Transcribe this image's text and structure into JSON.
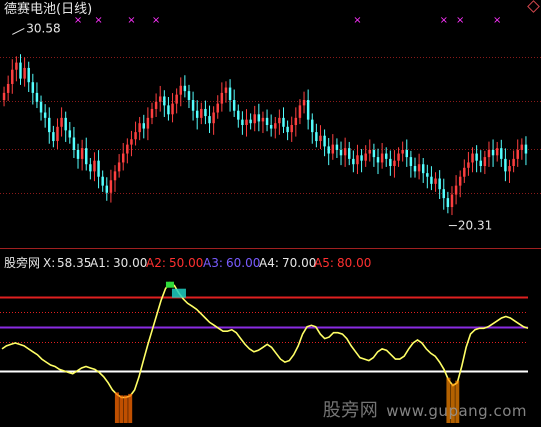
{
  "header": {
    "stock_title": "德赛电池(日线)",
    "indicator_name": "股旁网",
    "params": [
      {
        "label": "X:",
        "value": "58.35",
        "color": "#e6e6e6"
      },
      {
        "label": "A1:",
        "value": "30.00",
        "color": "#e6e6e6"
      },
      {
        "label": "A2:",
        "value": "50.00",
        "color": "#ff3030"
      },
      {
        "label": "A3:",
        "value": "60.00",
        "color": "#7a5cff"
      },
      {
        "label": "A4:",
        "value": "70.00",
        "color": "#e6e6e6"
      },
      {
        "label": "A5:",
        "value": "80.00",
        "color": "#ff3030"
      }
    ]
  },
  "watermark": {
    "text": "股旁网",
    "url": "www.gupang.com"
  },
  "colors": {
    "up": "#ff4040",
    "down": "#54ffff",
    "line": "#ffff66",
    "level_red": "#e02020",
    "level_purple": "#8a2be2",
    "level_white": "#ffffff",
    "marker": "#ff33ff"
  },
  "chart_data": [
    {
      "type": "candlestick",
      "title": "德赛电池(日线)",
      "ylim": [
        19.5,
        31.5
      ],
      "grid": true,
      "annotations": [
        {
          "label": "30.58",
          "index": 2,
          "value": 30.58,
          "kind": "high"
        },
        {
          "label": "20.31",
          "index": 108,
          "value": 20.31,
          "kind": "low"
        }
      ],
      "markers_top": [
        18,
        23,
        31,
        37,
        86,
        107,
        111,
        120
      ],
      "close": [
        27.3,
        27.8,
        28.6,
        29.0,
        28.1,
        28.7,
        27.9,
        27.3,
        26.8,
        26.2,
        25.9,
        25.1,
        24.6,
        25.4,
        25.9,
        25.2,
        24.8,
        24.1,
        23.6,
        24.2,
        23.3,
        22.9,
        23.5,
        22.6,
        22.1,
        21.7,
        22.4,
        22.9,
        23.4,
        23.9,
        24.4,
        24.7,
        25.1,
        25.6,
        25.3,
        25.9,
        26.4,
        26.8,
        27.1,
        26.6,
        26.1,
        26.7,
        27.2,
        27.7,
        27.4,
        26.9,
        26.3,
        25.9,
        26.4,
        26.0,
        25.6,
        26.2,
        26.7,
        27.3,
        27.6,
        26.9,
        26.3,
        25.8,
        25.5,
        25.8,
        25.6,
        26.1,
        25.7,
        25.9,
        25.5,
        25.3,
        25.6,
        25.9,
        25.4,
        25.1,
        25.5,
        25.9,
        26.6,
        26.9,
        25.8,
        25.1,
        24.6,
        24.9,
        24.3,
        23.9,
        24.4,
        24.1,
        23.8,
        24.2,
        23.6,
        23.3,
        23.8,
        23.5,
        23.9,
        24.1,
        23.7,
        23.4,
        23.9,
        23.6,
        23.2,
        23.5,
        23.9,
        24.1,
        23.7,
        23.2,
        22.9,
        23.3,
        22.8,
        22.6,
        22.2,
        22.5,
        21.9,
        21.4,
        20.9,
        21.6,
        22.1,
        22.6,
        23.1,
        23.4,
        23.9,
        23.5,
        23.2,
        23.7,
        24.1,
        23.8,
        24.2,
        23.6,
        22.9,
        23.2,
        23.6,
        24.1,
        24.4,
        23.9
      ]
    },
    {
      "type": "line",
      "title": "股旁网",
      "ylim": [
        0,
        100
      ],
      "levels": [
        {
          "name": "A1",
          "value": 30.0
        },
        {
          "name": "A2",
          "value": 50.0
        },
        {
          "name": "A3",
          "value": 60.0
        },
        {
          "name": "A4",
          "value": 70.0
        },
        {
          "name": "A5",
          "value": 80.0
        }
      ],
      "values": [
        45,
        47,
        48,
        49,
        48,
        47,
        45,
        43,
        41,
        38,
        36,
        34,
        33,
        31,
        30,
        29,
        28,
        30,
        32,
        33,
        32,
        31,
        29,
        26,
        22,
        17,
        14,
        12,
        12,
        13,
        17,
        26,
        37,
        48,
        58,
        68,
        78,
        86,
        90,
        88,
        83,
        79,
        76,
        74,
        72,
        69,
        66,
        63,
        61,
        59,
        57,
        57,
        58,
        56,
        52,
        48,
        45,
        43,
        44,
        46,
        48,
        46,
        42,
        38,
        36,
        37,
        41,
        47,
        55,
        60,
        61,
        60,
        55,
        52,
        53,
        56,
        56,
        55,
        52,
        47,
        43,
        39,
        38,
        37,
        39,
        43,
        45,
        44,
        41,
        38,
        38,
        40,
        45,
        49,
        51,
        49,
        45,
        42,
        40,
        36,
        31,
        24,
        20,
        22,
        33,
        46,
        55,
        58,
        59,
        59,
        60,
        62,
        64,
        66,
        67,
        66,
        64,
        62,
        60,
        59
      ]
    }
  ]
}
